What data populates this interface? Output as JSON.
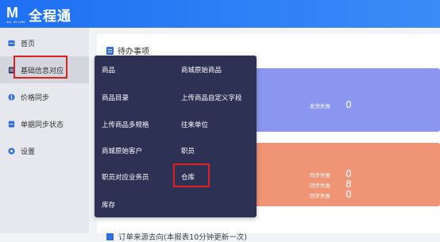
{
  "app": {
    "logo_text": "全程通",
    "logo_mark": "M",
    "logo_sub": "ALL IN LINK",
    "brand_color": "#1e6ff3"
  },
  "sidebar": {
    "items": [
      {
        "label": "首页",
        "icon": "home-icon"
      },
      {
        "label": "基础信息对应",
        "icon": "document-icon",
        "active": true
      },
      {
        "label": "价格同步",
        "icon": "price-icon"
      },
      {
        "label": "单据同步状态",
        "icon": "list-icon"
      },
      {
        "label": "设置",
        "icon": "gear-icon"
      }
    ]
  },
  "main": {
    "todo_title": "待办事项",
    "blue_panel": {
      "stats": [
        {
          "label": "发货失败",
          "value": "0"
        }
      ]
    },
    "orange_panel": {
      "stats": [
        {
          "label": "同步失败",
          "value": "0"
        },
        {
          "label": "同步失败",
          "value": "8"
        },
        {
          "label": "同步失败",
          "value": "0"
        }
      ]
    },
    "bottom_title": "订单来源去向(本报表10分钟更新一次)"
  },
  "dropdown": {
    "items": [
      "商品",
      "商城原始商品",
      "商品目录",
      "上传商品自定义字段",
      "上传商品多规格",
      "往来单位",
      "商城原始客户",
      "职员",
      "职员对应业务员",
      "仓库",
      "库存"
    ],
    "highlighted": "仓库"
  },
  "colors": {
    "panel_blue": "#8a96ef",
    "panel_orange": "#f09476",
    "dropdown_bg": "#2d3154",
    "highlight": "#e02020"
  }
}
